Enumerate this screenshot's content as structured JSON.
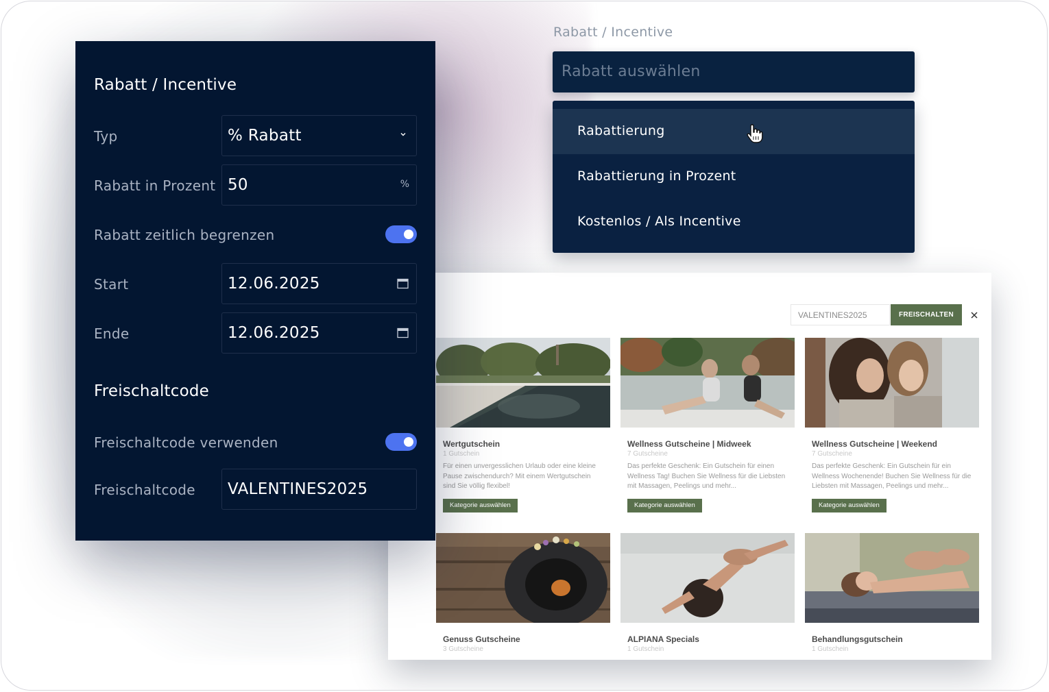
{
  "settings": {
    "section_discount_title": "Rabatt / Incentive",
    "type_label": "Typ",
    "type_value": "% Rabatt",
    "percent_label": "Rabatt in Prozent",
    "percent_value": "50",
    "percent_suffix": "%",
    "time_limit_label": "Rabatt zeitlich begrenzen",
    "time_limit_enabled": true,
    "start_label": "Start",
    "start_value": "12.06.2025",
    "end_label": "Ende",
    "end_value": "12.06.2025",
    "section_code_title": "Freischaltcode",
    "use_code_label": "Freischaltcode verwenden",
    "use_code_enabled": true,
    "code_label": "Freischaltcode",
    "code_value": "VALENTINES2025",
    "toggle_color": "#4d73f0",
    "panel_color": "#031631"
  },
  "dropdown": {
    "label": "Rabatt / Incentive",
    "placeholder": "Rabatt auswählen",
    "options": [
      {
        "label": "Rabattierung",
        "hovered": true
      },
      {
        "label": "Rabattierung in Prozent",
        "hovered": false
      },
      {
        "label": "Kostenlos / Als Incentive",
        "hovered": false
      }
    ]
  },
  "shop": {
    "code_input_value": "VALENTINES2025",
    "unlock_button": "FREISCHALTEN",
    "accent_color": "#59704c",
    "cards": [
      {
        "title": "Wertgutschein",
        "count": "1 Gutschein",
        "description": "Für einen unvergesslichen Urlaub oder eine kleine Pause zwischendurch? Mit einem Wertgutschein sind Sie völlig flexibel!",
        "button": "Kategorie auswählen",
        "image": "resort-pool-photo"
      },
      {
        "title": "Wellness Gutscheine | Midweek",
        "count": "7 Gutscheine",
        "description": "Das perfekte Geschenk: Ein Gutschein für einen Wellness Tag! Buchen Sie Wellness für die Liebsten mit Massagen, Peelings und mehr...",
        "button": "Kategorie auswählen",
        "image": "women-pool-photo"
      },
      {
        "title": "Wellness Gutscheine | Weekend",
        "count": "7 Gutscheine",
        "description": "Das perfekte Geschenk: Ein Gutschein für ein Wellness Wochenende! Buchen Sie Wellness für die Liebsten mit Massagen, Peelings und mehr...",
        "button": "Kategorie auswählen",
        "image": "women-bathrobes-photo"
      },
      {
        "title": "Genuss Gutscheine",
        "count": "3 Gutscheine",
        "description": "",
        "button": "",
        "image": "gourmet-plate-photo"
      },
      {
        "title": "ALPIANA Specials",
        "count": "1 Gutschein",
        "description": "",
        "button": "",
        "image": "woman-relaxing-photo"
      },
      {
        "title": "Behandlungsgutschein",
        "count": "1 Gutschein",
        "description": "",
        "button": "",
        "image": "massage-photo"
      }
    ]
  }
}
